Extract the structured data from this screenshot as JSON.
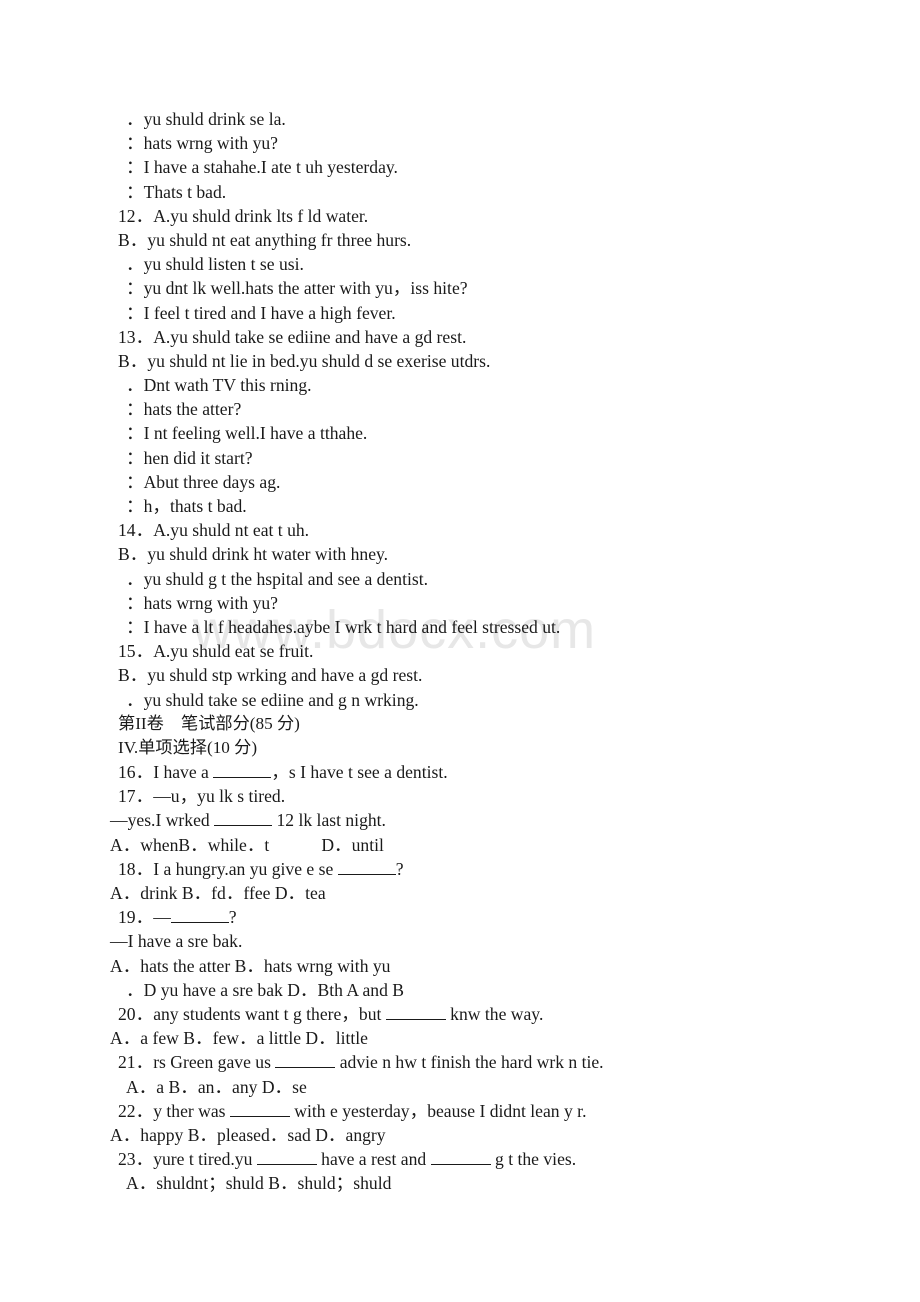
{
  "document": {
    "watermark": "www.bdocx.com",
    "text_color": "#1a1a1a",
    "watermark_color": "#e7e7e7",
    "background_color": "#ffffff"
  },
  "lines": [
    {
      "id": "l01",
      "indent": true,
      "text": "．yu shuld drink se la."
    },
    {
      "id": "l02",
      "indent": true,
      "text": "：hats wrng with yu?"
    },
    {
      "id": "l03",
      "indent": true,
      "text": "：I have a stahahe.I ate t uh yesterday."
    },
    {
      "id": "l04",
      "indent": true,
      "text": "：Thats t bad."
    },
    {
      "id": "l05",
      "indent": false,
      "text": "12．A.yu shuld drink lts f ld water."
    },
    {
      "id": "l06",
      "indent": false,
      "text": "B．yu shuld nt eat anything fr three hurs."
    },
    {
      "id": "l07",
      "indent": true,
      "text": "．yu shuld listen t se usi."
    },
    {
      "id": "l08",
      "indent": true,
      "text": "：yu dnt lk well.hats the atter with yu，iss hite?"
    },
    {
      "id": "l09",
      "indent": true,
      "text": "：I feel t tired and I have a high fever."
    },
    {
      "id": "l10",
      "indent": false,
      "text": "13．A.yu shuld take se ediine and have a gd rest."
    },
    {
      "id": "l11",
      "indent": false,
      "text": "B．yu shuld nt lie in bed.yu shuld d se exerise utdrs."
    },
    {
      "id": "l12",
      "indent": true,
      "text": "．Dnt wath TV this rning."
    },
    {
      "id": "l13",
      "indent": true,
      "text": "：hats the atter?"
    },
    {
      "id": "l14",
      "indent": true,
      "text": "：I nt feeling well.I have a tthahe."
    },
    {
      "id": "l15",
      "indent": true,
      "text": "：hen did it start?"
    },
    {
      "id": "l16",
      "indent": true,
      "text": "：Abut three days ag."
    },
    {
      "id": "l17",
      "indent": true,
      "text": "：h，thats t bad."
    },
    {
      "id": "l18",
      "indent": false,
      "text": "14．A.yu shuld nt eat t uh."
    },
    {
      "id": "l19",
      "indent": false,
      "text": "B．yu shuld drink ht water with hney."
    },
    {
      "id": "l20",
      "indent": true,
      "text": "．yu shuld g t the hspital and see a dentist."
    },
    {
      "id": "l21",
      "indent": true,
      "text": "：hats wrng with yu?"
    },
    {
      "id": "l22",
      "indent": true,
      "text": "：I have a lt f headahes.aybe I wrk t hard and feel stressed ut."
    },
    {
      "id": "l23",
      "indent": false,
      "text": "15．A.yu shuld eat se fruit."
    },
    {
      "id": "l24",
      "indent": false,
      "text": "B．yu shuld stp wrking and have a gd rest."
    },
    {
      "id": "l25",
      "indent": true,
      "text": "．yu shuld take se ediine and g n wrking."
    },
    {
      "id": "l26",
      "indent": false,
      "chinese": true,
      "text": "第II卷　笔试部分(85 分)"
    },
    {
      "id": "l27",
      "indent": false,
      "chinese": true,
      "text": "IV.单项选择(10 分)"
    }
  ],
  "questions": {
    "q16": {
      "prefix": "16．I have a ",
      "suffix": "，s I have t see a dentist."
    },
    "q17": {
      "line1": "17．—u，yu lk s tired.",
      "line2_prefix": "—yes.I wrked ",
      "line2_suffix": " 12 lk last night.",
      "options": "A．whenB．while．t",
      "options_tail": "D．until"
    },
    "q18": {
      "prefix": "18．I a hungry.an yu give e se ",
      "suffix": "?",
      "options": "A．drink B．fd．ffee D．tea"
    },
    "q19": {
      "line1_prefix": "19．—",
      "line1_suffix": "?",
      "line2": "—I have a sre bak.",
      "options_a": "A．hats the atter B．hats wrng with yu",
      "options_c": "．D yu have a sre bak D．Bth A and B"
    },
    "q20": {
      "prefix": "20．any students want t g there，but ",
      "suffix": " knw the way.",
      "options": "A．a few B．few．a little D．little"
    },
    "q21": {
      "prefix": "21．rs Green gave us ",
      "suffix": " advie n hw t finish the hard wrk n tie.",
      "options": "A．a B．an．any D．se"
    },
    "q22": {
      "prefix": "22．y ther was ",
      "suffix": " with e yesterday，beause I didnt lean y r.",
      "options": "A．happy B．pleased．sad D．angry"
    },
    "q23": {
      "prefix": "23．yure t tired.yu ",
      "middle": " have a rest and ",
      "suffix": " g t the vies.",
      "options": "A．shuldnt；shuld B．shuld；shuld"
    }
  }
}
